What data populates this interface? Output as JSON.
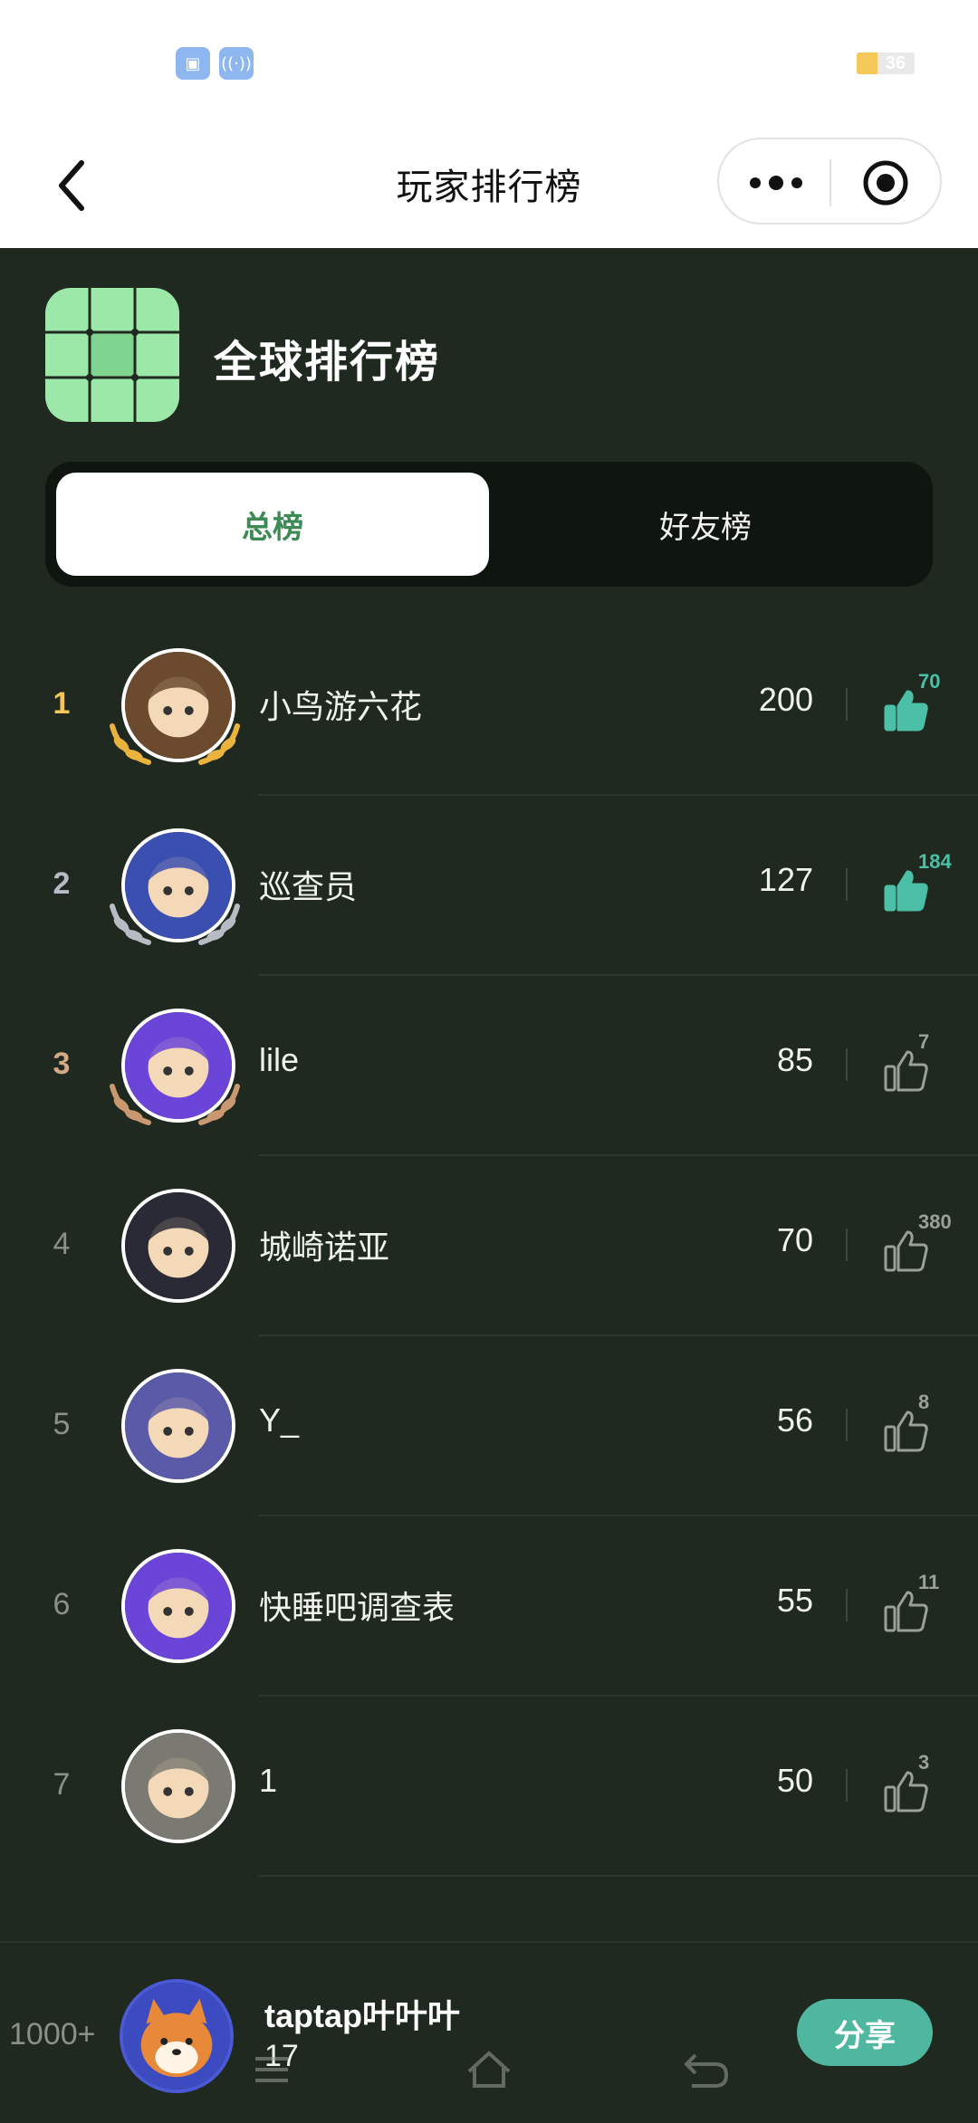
{
  "status_bar": {
    "icons": [
      "screen-cast-icon",
      "hotspot-icon"
    ],
    "battery_level": "36"
  },
  "navbar": {
    "title": "玩家排行榜",
    "back_icon": "chevron-left-icon",
    "more_icon": "more-dots-icon",
    "target_icon": "target-icon"
  },
  "board": {
    "logo_icon": "grid-board-icon",
    "title": "全球排行榜"
  },
  "tabs": [
    {
      "label": "总榜",
      "active": true
    },
    {
      "label": "好友榜",
      "active": false
    }
  ],
  "leaderboard": [
    {
      "rank": "1",
      "name": "小鸟游六花",
      "score": "200",
      "likes": "70",
      "liked": true,
      "medal": "gold",
      "avatar_color": "#6b4a2e"
    },
    {
      "rank": "2",
      "name": "巡查员",
      "score": "127",
      "likes": "184",
      "liked": true,
      "medal": "silver",
      "avatar_color": "#3a4fb0"
    },
    {
      "rank": "3",
      "name": "lile",
      "score": "85",
      "likes": "7",
      "liked": false,
      "medal": "bronze",
      "avatar_color": "#6a45d8"
    },
    {
      "rank": "4",
      "name": "城崎诺亚",
      "score": "70",
      "likes": "380",
      "liked": false,
      "medal": "",
      "avatar_color": "#2a2a36"
    },
    {
      "rank": "5",
      "name": "Y_",
      "score": "56",
      "likes": "8",
      "liked": false,
      "medal": "",
      "avatar_color": "#5a5aa8"
    },
    {
      "rank": "6",
      "name": "快睡吧调查表",
      "score": "55",
      "likes": "11",
      "liked": false,
      "medal": "",
      "avatar_color": "#6a45d8"
    },
    {
      "rank": "7",
      "name": "1",
      "score": "50",
      "likes": "3",
      "liked": false,
      "medal": "",
      "avatar_color": "#7a7a72"
    }
  ],
  "me": {
    "rank": "1000+",
    "name": "taptap叶叶叶",
    "score": "17",
    "share_label": "分享",
    "avatar_color": "#3c4cc0"
  },
  "system_nav": [
    "menu-icon",
    "home-icon",
    "back-arrow-icon"
  ],
  "colors": {
    "background": "#1f291f",
    "accent": "#4fb7a0",
    "tab_active_text": "#3e8a55",
    "logo_green": "#9be8a8",
    "gold": "#f3c65a"
  }
}
